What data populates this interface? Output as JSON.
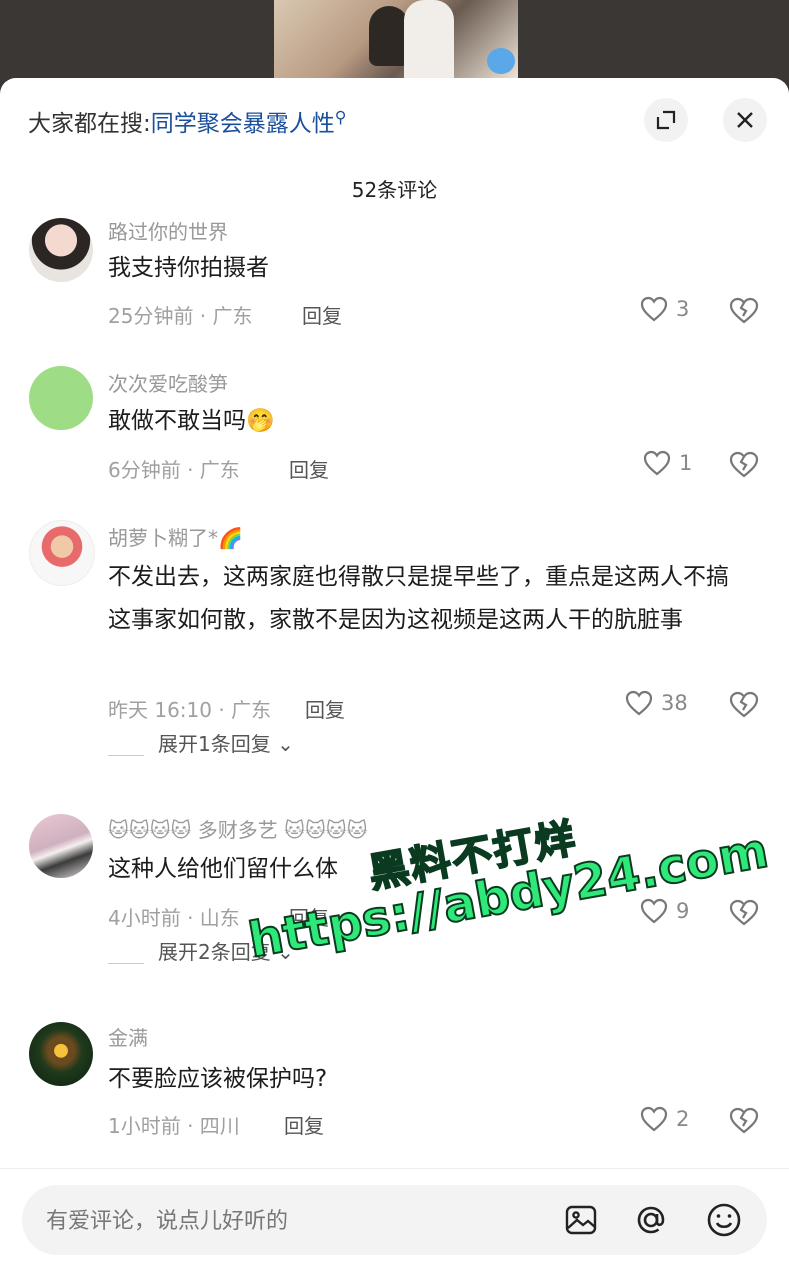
{
  "header": {
    "search_prefix": "大家都在搜:",
    "search_keyword": "同学聚会暴露人性",
    "comment_count_title": "52条评论"
  },
  "comments": [
    {
      "username": "路过你的世界",
      "text": "我支持你拍摄者",
      "meta": "25分钟前 · 广东",
      "reply": "回复",
      "likes": "3"
    },
    {
      "username": "次次爱吃酸笋",
      "text": "敢做不敢当吗🤭",
      "meta": "6分钟前 · 广东",
      "reply": "回复",
      "likes": "1"
    },
    {
      "username": "胡萝卜糊了*🌈",
      "text": "不发出去，这两家庭也得散只是提早些了，重点是这两人不搞这事家如何散，家散不是因为这视频是这两人干的肮脏事",
      "meta": "昨天 16:10 · 广东",
      "reply": "回复",
      "likes": "38",
      "expand": "展开1条回复"
    },
    {
      "username": "🐱🐱🐱🐱 多财多艺 🐱🐱🐱🐱",
      "text": "这种人给他们留什么体",
      "meta": "4小时前 · 山东",
      "reply": "回复",
      "likes": "9",
      "expand": "展开2条回复"
    },
    {
      "username": "金满",
      "text": "不要脸应该被保护吗?",
      "meta": "1小时前 · 四川",
      "reply": "回复",
      "likes": "2"
    }
  ],
  "input": {
    "placeholder": "有爱评论，说点儿好听的"
  },
  "watermark": {
    "line1": "黑料不打烊",
    "line2": "https://abdy24.com"
  },
  "colors": {
    "keyword": "#1a4f9c",
    "watermark": "#2ee87a"
  }
}
